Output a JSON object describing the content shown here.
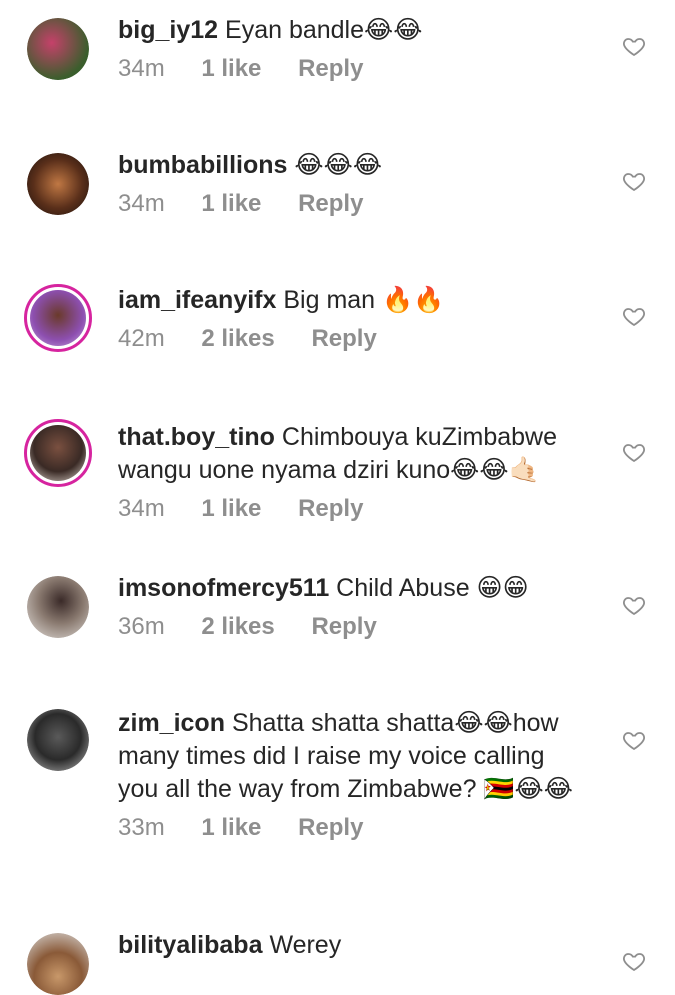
{
  "comments": [
    {
      "username": "big_iy12",
      "text": "Eyan bandle😂😂",
      "time": "34m",
      "likes": "1 like",
      "reply": "Reply"
    },
    {
      "username": "bumbabillions",
      "text": "😂😂😂",
      "time": "34m",
      "likes": "1 like",
      "reply": "Reply"
    },
    {
      "username": "iam_ifeanyifx",
      "text": "Big man 🔥🔥",
      "time": "42m",
      "likes": "2 likes",
      "reply": "Reply"
    },
    {
      "username": "that.boy_tino",
      "text": "Chimbouya kuZimbabwe wangu uone nyama dziri kuno😂😂🤙🏻",
      "time": "34m",
      "likes": "1 like",
      "reply": "Reply"
    },
    {
      "username": "imsonofmercy511",
      "text": "Child Abuse 😁😁",
      "time": "36m",
      "likes": "2 likes",
      "reply": "Reply"
    },
    {
      "username": "zim_icon",
      "text": "Shatta shatta shatta😂😂how many times did I raise my voice calling you all the way from Zimbabwe? 🇿🇼😂😂",
      "time": "33m",
      "likes": "1 like",
      "reply": "Reply"
    },
    {
      "username": "bilityalibaba",
      "text": "Werey",
      "time": "",
      "likes": "",
      "reply": ""
    }
  ],
  "colors": {
    "meta": "#8e8e8e",
    "story_ring": "#d6249f",
    "text": "#262626"
  }
}
